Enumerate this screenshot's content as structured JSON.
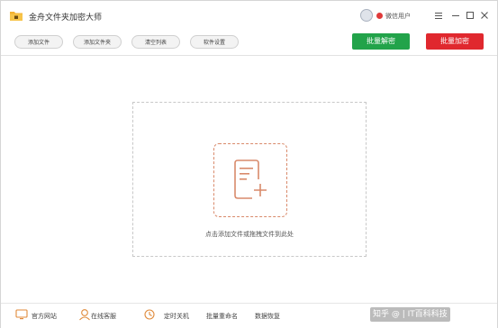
{
  "app": {
    "title": "金舟文件夹加密大师",
    "user_label": "微信用户"
  },
  "toolbar": {
    "add_file": "添加文件",
    "add_folder": "添加文件夹",
    "clear_list": "清空列表",
    "settings": "软件设置",
    "batch_decrypt": "批量解密",
    "batch_encrypt": "批量加密"
  },
  "main": {
    "drop_hint": "点击添加文件或拖拽文件到此处"
  },
  "footer": {
    "website": "官方网站",
    "support": "在线客服",
    "timer_shutdown": "定时关机",
    "batch_rename": "批量重命名",
    "data_recovery": "数据恢复",
    "watermark": "知乎 @ | IT百科科技"
  },
  "colors": {
    "decrypt": "#22a34a",
    "encrypt": "#e0282e",
    "accent": "#d98a6b"
  },
  "icons": [
    "folder-lock-icon",
    "avatar-icon",
    "wechat-icon",
    "menu-icon",
    "minimize-icon",
    "maximize-icon",
    "close-icon",
    "document-plus-icon",
    "website-icon",
    "support-icon",
    "timer-icon"
  ]
}
